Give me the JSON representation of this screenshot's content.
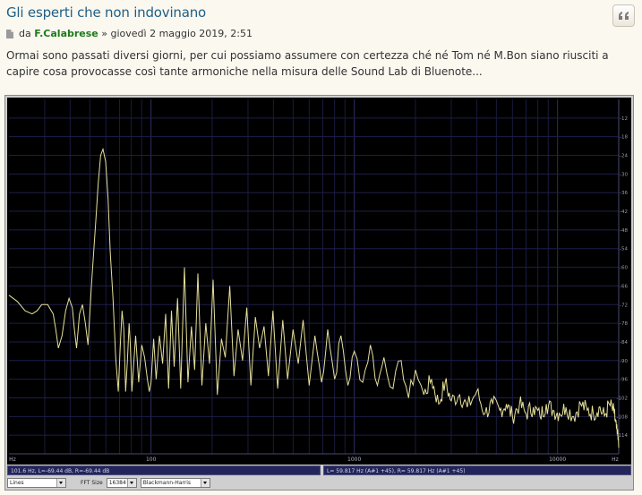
{
  "post": {
    "title": "Gli esperti che non indovinano",
    "meta_prefix": "da",
    "author": "F.Calabrese",
    "meta_separator": "»",
    "date": "giovedì 2 maggio 2019, 2:51",
    "body": "Ormai sono passati diversi giorni, per cui possiamo assumere con certezza ché né Tom né M.Bon siano riusciti a capire cosa provocasse così tante armoniche nella misura delle Sound Lab di Bluenote..."
  },
  "icons": {
    "quote": "quote-icon",
    "post_file": "file-icon"
  },
  "analyzer": {
    "status_left": "101.6 Hz, L=-69.44 dB, R=-69.44 dB",
    "status_right": "L= 59.817 Hz (A#1 +45), R= 59.817 Hz (A#1 +45)",
    "view_mode": "Lines",
    "fft_size_label": "FFT Size",
    "fft_size": "16384",
    "window": "Blackmann-Harris"
  },
  "chart_data": {
    "type": "line",
    "title": "",
    "xlabel": "Hz",
    "ylabel": "dB",
    "x_scale": "log",
    "xlim": [
      20,
      20000
    ],
    "ylim": [
      -120,
      -6
    ],
    "x_ticks": [
      "Hz",
      "100",
      "1000",
      "10000",
      "Hz"
    ],
    "y_ticks": [
      "-12",
      "-18",
      "-24",
      "-30",
      "-36",
      "-42",
      "-48",
      "-54",
      "-60",
      "-66",
      "-72",
      "-78",
      "-84",
      "-90",
      "-96",
      "-102",
      "-108",
      "-114"
    ],
    "grid": true,
    "series": [
      {
        "color": "#e6e09a",
        "x": [
          20,
          22,
          24,
          26,
          27.5,
          29,
          31,
          33,
          34,
          35,
          36.5,
          38,
          39.5,
          41,
          42,
          43,
          44.5,
          46,
          47.5,
          49,
          51,
          53.5,
          55,
          56.5,
          58,
          59.8,
          61.5,
          63,
          65,
          67,
          69,
          70.5,
          72,
          73.5,
          75,
          76.5,
          78,
          79,
          80.5,
          82,
          84,
          87,
          90,
          93,
          96,
          98,
          100,
          103,
          106,
          110,
          114,
          118,
          122,
          126,
          130,
          135,
          140,
          146,
          152,
          158,
          164,
          170,
          178,
          186,
          194,
          202,
          212,
          222,
          232,
          244,
          256,
          268,
          282,
          296,
          310,
          326,
          342,
          360,
          378,
          398,
          420,
          445,
          470,
          500,
          530,
          560,
          600,
          640,
          690,
          740,
          800,
          860,
          930,
          1000,
          1100,
          1200,
          1300,
          1400,
          1550,
          1700,
          1850,
          2000,
          2200,
          2400,
          2600,
          2800,
          3000,
          3300,
          3600,
          4000,
          4400,
          4800,
          5200,
          5600,
          6000,
          6500,
          7000,
          7600,
          8200,
          8800,
          9500,
          10200,
          11000,
          12000,
          13000,
          14000,
          15000,
          16000,
          17000,
          18000,
          19000,
          19500,
          20000
        ],
        "y": [
          -69,
          -71,
          -74,
          -75,
          -74,
          -72,
          -72,
          -75,
          -80,
          -86,
          -82,
          -74,
          -70,
          -73,
          -80,
          -86,
          -75,
          -72,
          -78,
          -85,
          -65,
          -45,
          -33,
          -24,
          -22,
          -26,
          -38,
          -55,
          -70,
          -89,
          -100,
          -86,
          -74,
          -80,
          -100,
          -90,
          -78,
          -84,
          -100,
          -92,
          -82,
          -97,
          -85,
          -89,
          -96,
          -100,
          -97,
          -83,
          -96,
          -82,
          -91,
          -75,
          -99,
          -74,
          -92,
          -70,
          -99,
          -60,
          -97,
          -79,
          -93,
          -62,
          -98,
          -78,
          -91,
          -64,
          -101,
          -83,
          -89,
          -66,
          -95,
          -80,
          -90,
          -73,
          -98,
          -76,
          -86,
          -79,
          -95,
          -74,
          -99,
          -77,
          -96,
          -80,
          -91,
          -77,
          -98,
          -82,
          -97,
          -80,
          -96,
          -82,
          -98,
          -87,
          -97,
          -85,
          -98,
          -89,
          -99,
          -90,
          -102,
          -93,
          -101,
          -96,
          -104,
          -97,
          -103,
          -101,
          -105,
          -100,
          -107,
          -104,
          -106,
          -104,
          -108,
          -104,
          -107,
          -105,
          -108,
          -104,
          -106,
          -107,
          -105,
          -108,
          -104,
          -106,
          -107,
          -105,
          -108,
          -104,
          -107,
          -112,
          -118
        ]
      }
    ]
  }
}
